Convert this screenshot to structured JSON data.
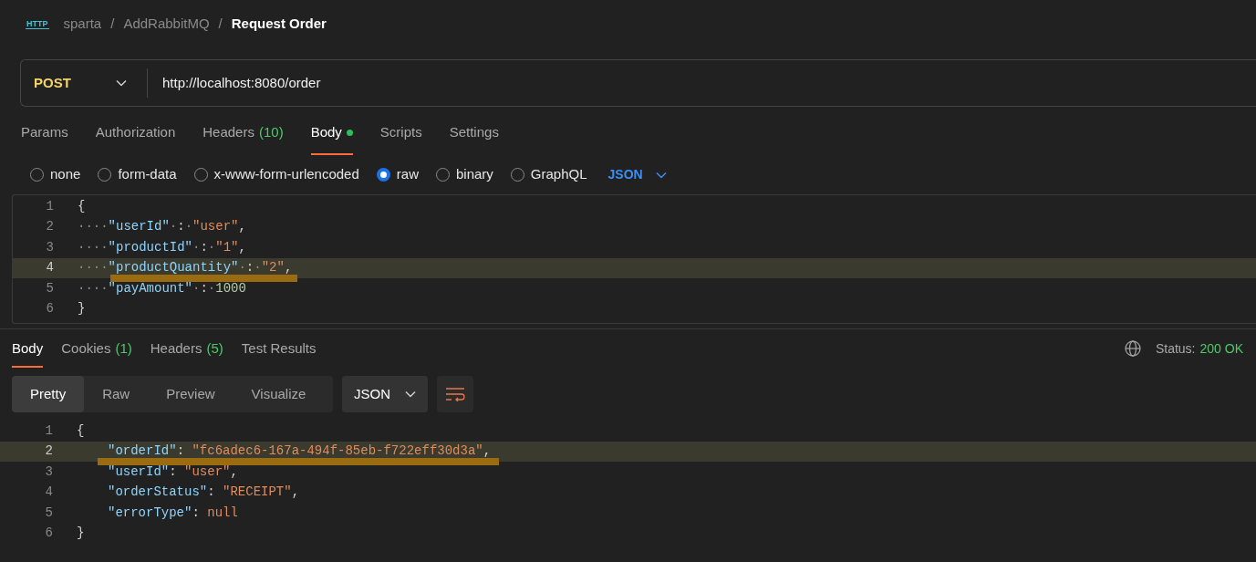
{
  "breadcrumb": {
    "items": [
      "sparta",
      "AddRabbitMQ"
    ],
    "separator": "/",
    "current": "Request Order",
    "icon_text": "HTTP"
  },
  "request": {
    "method": "POST",
    "url": "http://localhost:8080/order"
  },
  "request_tabs": [
    {
      "label": "Params",
      "selected": false
    },
    {
      "label": "Authorization",
      "selected": false
    },
    {
      "label": "Headers",
      "count": "(10)",
      "selected": false
    },
    {
      "label": "Body",
      "dot": true,
      "selected": true
    },
    {
      "label": "Scripts",
      "selected": false
    },
    {
      "label": "Settings",
      "selected": false
    }
  ],
  "body_types": [
    {
      "label": "none",
      "selected": false
    },
    {
      "label": "form-data",
      "selected": false
    },
    {
      "label": "x-www-form-urlencoded",
      "selected": false
    },
    {
      "label": "raw",
      "selected": true
    },
    {
      "label": "binary",
      "selected": false
    },
    {
      "label": "GraphQL",
      "selected": false
    }
  ],
  "body_format": "JSON",
  "request_body": [
    {
      "number": "1",
      "current": false,
      "marked": false,
      "tokens": [
        {
          "kind": "punct",
          "t": "{"
        }
      ]
    },
    {
      "number": "2",
      "current": false,
      "marked": false,
      "tokens": [
        {
          "kind": "ws",
          "t": "····"
        },
        {
          "kind": "key",
          "t": "\"userId\""
        },
        {
          "kind": "ws",
          "t": "·"
        },
        {
          "kind": "punct",
          "t": ":"
        },
        {
          "kind": "ws",
          "t": "·"
        },
        {
          "kind": "str",
          "t": "\"user\""
        },
        {
          "kind": "punct",
          "t": ","
        }
      ]
    },
    {
      "number": "3",
      "current": false,
      "marked": false,
      "tokens": [
        {
          "kind": "ws",
          "t": "····"
        },
        {
          "kind": "key",
          "t": "\"productId\""
        },
        {
          "kind": "ws",
          "t": "·"
        },
        {
          "kind": "punct",
          "t": ":"
        },
        {
          "kind": "ws",
          "t": "·"
        },
        {
          "kind": "str",
          "t": "\"1\""
        },
        {
          "kind": "punct",
          "t": ","
        }
      ]
    },
    {
      "number": "4",
      "current": true,
      "marked": true,
      "tokens": [
        {
          "kind": "ws",
          "t": "····"
        },
        {
          "kind": "key",
          "t": "\"productQuantity\""
        },
        {
          "kind": "ws",
          "t": "·"
        },
        {
          "kind": "punct",
          "t": ":"
        },
        {
          "kind": "ws",
          "t": "·"
        },
        {
          "kind": "str",
          "t": "\"2\""
        },
        {
          "kind": "punct",
          "t": ","
        }
      ]
    },
    {
      "number": "5",
      "current": false,
      "marked": false,
      "tokens": [
        {
          "kind": "ws",
          "t": "····"
        },
        {
          "kind": "key",
          "t": "\"payAmount\""
        },
        {
          "kind": "ws",
          "t": "·"
        },
        {
          "kind": "punct",
          "t": ":"
        },
        {
          "kind": "ws",
          "t": "·"
        },
        {
          "kind": "num",
          "t": "1000"
        }
      ]
    },
    {
      "number": "6",
      "current": false,
      "marked": false,
      "tokens": [
        {
          "kind": "punct",
          "t": "}"
        }
      ]
    }
  ],
  "response_tabs": [
    {
      "label": "Body",
      "selected": true
    },
    {
      "label": "Cookies",
      "count": "(1)",
      "selected": false
    },
    {
      "label": "Headers",
      "count": "(5)",
      "selected": false
    },
    {
      "label": "Test Results",
      "selected": false
    }
  ],
  "status": {
    "label": "Status:",
    "value": "200 OK"
  },
  "view_modes": [
    {
      "label": "Pretty",
      "selected": true
    },
    {
      "label": "Raw",
      "selected": false
    },
    {
      "label": "Preview",
      "selected": false
    },
    {
      "label": "Visualize",
      "selected": false
    }
  ],
  "response_format": "JSON",
  "response_body": [
    {
      "number": "1",
      "current": false,
      "marked": false,
      "tokens": [
        {
          "kind": "punct",
          "t": "{"
        }
      ]
    },
    {
      "number": "2",
      "current": true,
      "marked": true,
      "indented": true,
      "tokens": [
        {
          "kind": "key",
          "t": "\"orderId\""
        },
        {
          "kind": "punct",
          "t": ": "
        },
        {
          "kind": "str",
          "t": "\"fc6adec6-167a-494f-85eb-f722eff30d3a\""
        },
        {
          "kind": "punct",
          "t": ","
        }
      ]
    },
    {
      "number": "3",
      "current": false,
      "marked": false,
      "indented": true,
      "tokens": [
        {
          "kind": "key",
          "t": "\"userId\""
        },
        {
          "kind": "punct",
          "t": ": "
        },
        {
          "kind": "str",
          "t": "\"user\""
        },
        {
          "kind": "punct",
          "t": ","
        }
      ]
    },
    {
      "number": "4",
      "current": false,
      "marked": false,
      "indented": true,
      "tokens": [
        {
          "kind": "key",
          "t": "\"orderStatus\""
        },
        {
          "kind": "punct",
          "t": ": "
        },
        {
          "kind": "str",
          "t": "\"RECEIPT\""
        },
        {
          "kind": "punct",
          "t": ","
        }
      ]
    },
    {
      "number": "5",
      "current": false,
      "marked": false,
      "indented": true,
      "tokens": [
        {
          "kind": "key",
          "t": "\"errorType\""
        },
        {
          "kind": "punct",
          "t": ": "
        },
        {
          "kind": "null",
          "t": "null"
        }
      ]
    },
    {
      "number": "6",
      "current": false,
      "marked": false,
      "tokens": [
        {
          "kind": "punct",
          "t": "}"
        }
      ]
    }
  ]
}
